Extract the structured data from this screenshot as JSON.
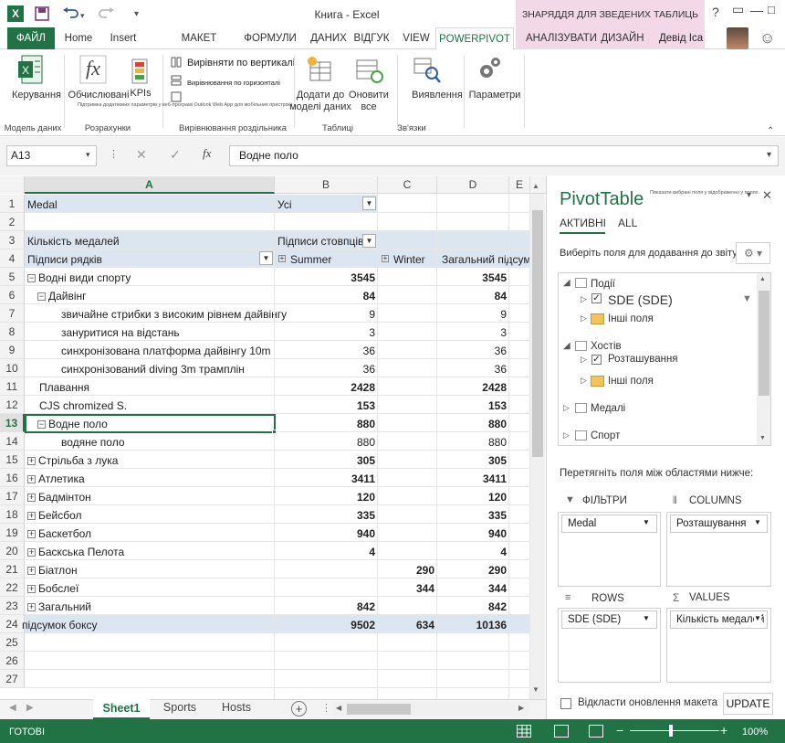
{
  "titlebar": {
    "title": "Книга - Excel",
    "context_label": "ЗНАРЯДДЯ ДЛЯ ЗВЕДЕНИХ ТАБЛИЦЬ",
    "help": "?"
  },
  "tabs": [
    "ФАЙЛ",
    "Home",
    "Insert",
    "МАКЕТ СТОРІНКИ",
    "ФОРМУЛИ",
    "ДАНИХ",
    "ВІДГУК",
    "VIEW",
    "POWERPIVOT",
    "АНАЛІЗУВАТИ",
    "ДИЗАЙН"
  ],
  "user": "Девід Іса",
  "ribbon": {
    "manage": "Керування",
    "calc": "Обчислювані",
    "kpis": "KPIs",
    "align_v": "Вирівняти по вертикалі",
    "align_h": "Вирівнювання по горизонталі",
    "tiny": "Підтримка додаткових параметрів у веб-програмі Outlook Web App для мобільних пристроїв",
    "add_model_1": "Додати до",
    "add_model_2": "моделі даних",
    "refresh_1": "Оновити",
    "refresh_2": "все",
    "detect": "Виявлення",
    "settings": "Параметри",
    "g_model": "Модель даних",
    "g_calc": "Розрахунки",
    "g_align": "Вирівнювання роздільника",
    "g_tables": "Таблиці",
    "g_rel": "Зв'язки"
  },
  "formula": {
    "namebox": "A13",
    "value": "Водне поло"
  },
  "columns": [
    "A",
    "B",
    "C",
    "D",
    "E"
  ],
  "rows": [
    {
      "n": "1",
      "a": "Medal",
      "b": "Усі"
    },
    {
      "n": "2"
    },
    {
      "n": "3",
      "a": "Кількість медалей",
      "b": "Підписи стовпців"
    },
    {
      "n": "4",
      "a": "Підписи рядків",
      "b": "Summer",
      "c": "Winter",
      "d": "Загальний підсумок"
    },
    {
      "n": "5",
      "a": "Водні види спорту",
      "b": "3545",
      "d": "3545"
    },
    {
      "n": "6",
      "a": "Дайвінг",
      "b": "84",
      "d": "84"
    },
    {
      "n": "7",
      "a": "звичайне стрибки з високим рівнем дайвінгу",
      "b": "9",
      "d": "9"
    },
    {
      "n": "8",
      "a": "занурити­ся на відстань",
      "b": "3",
      "d": "3"
    },
    {
      "n": "9",
      "a": "синхронізована платформа дайвінгу 10m",
      "b": "36",
      "d": "36"
    },
    {
      "n": "10",
      "a": "синхронізований diving 3m трамплін",
      "b": "36",
      "d": "36"
    },
    {
      "n": "11",
      "a": "Плавання",
      "b": "2428",
      "d": "2428"
    },
    {
      "n": "12",
      "a": "CJS chromized S.",
      "b": "153",
      "d": "153"
    },
    {
      "n": "13",
      "a": "Водне поло",
      "b": "880",
      "d": "880"
    },
    {
      "n": "14",
      "a": "водяне поло",
      "b": "880",
      "d": "880"
    },
    {
      "n": "15",
      "a": "Стрільба з лука",
      "b": "305",
      "d": "305"
    },
    {
      "n": "16",
      "a": "Атлетика",
      "b": "3411",
      "d": "3411"
    },
    {
      "n": "17",
      "a": "Бадмінтон",
      "b": "120",
      "d": "120"
    },
    {
      "n": "18",
      "a": "Бейсбол",
      "b": "335",
      "d": "335"
    },
    {
      "n": "19",
      "a": "Баскетбол",
      "b": "940",
      "d": "940"
    },
    {
      "n": "20",
      "a": "Баскська Пелота",
      "b": "4",
      "d": "4"
    },
    {
      "n": "21",
      "a": "Біатлон",
      "c": "290",
      "d": "290"
    },
    {
      "n": "22",
      "a": "Бобслеї",
      "c": "344",
      "d": "344"
    },
    {
      "n": "23",
      "a": "Загальний",
      "b": "842",
      "d": "842"
    },
    {
      "n": "24",
      "a": "підсумок боксу",
      "b": "9502",
      "c": "634",
      "d": "10136"
    },
    {
      "n": "25"
    },
    {
      "n": "26"
    },
    {
      "n": "27"
    }
  ],
  "sheets": [
    "Sheet1",
    "Sports",
    "Hosts"
  ],
  "status": {
    "ready": "ГОТОВІ",
    "zoom": "100%"
  },
  "pivot": {
    "title": "PivotTable",
    "subtitle": "Показати вибрані поля у відображенні у полях.",
    "tab_active": "АКТИВНІ",
    "tab_all": "ALL",
    "choose": "Виберіть поля для додавання до звіту:",
    "fields": {
      "events": "Події",
      "sde": "SDE (SDE)",
      "other1": "Інші поля",
      "hosts": "Хостів",
      "location": "Розташування",
      "other2": "Інші поля",
      "medals": "Медалі",
      "sport": "Спорт"
    },
    "drag": "Перетягніть поля між областями нижче:",
    "filters": "ФІЛЬТРИ",
    "columns": "COLUMNS",
    "rows": "ROWS",
    "values": "VALUES",
    "filter_value": "Medal",
    "columns_value": "Розташування",
    "rows_value": "SDE (SDE)",
    "values_value": "Кількість медалей",
    "defer": "Відкласти оновлення макета",
    "update": "UPDATE"
  }
}
